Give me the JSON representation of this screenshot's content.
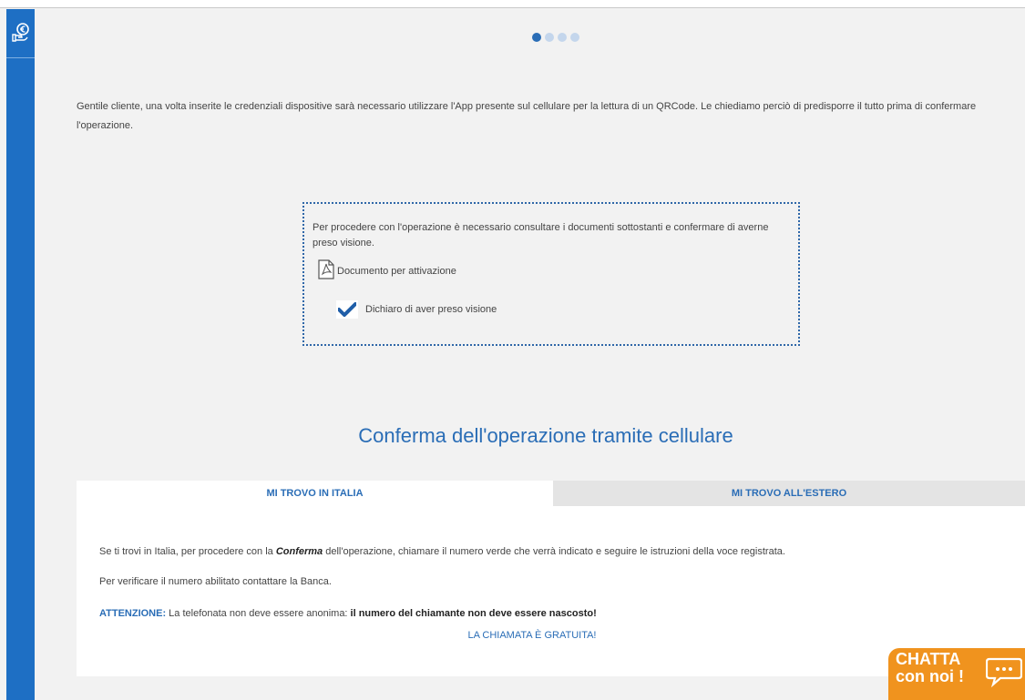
{
  "progress": {
    "total_steps": 4,
    "current_step": 1
  },
  "intro": {
    "text": "Gentile cliente, una volta inserite le credenziali dispositive sarà necessario utilizzare l'App presente sul cellulare per la lettura di un QRCode. Le chiediamo perciò di predisporre il tutto prima di confermare l'operazione."
  },
  "documents": {
    "instruction": "Per procedere con l'operazione è necessario consultare i documenti sottostanti e confermare di averne preso visione.",
    "link_label": "Documento per attivazione",
    "checkbox_label": "Dichiaro di aver preso visione",
    "checkbox_checked": true
  },
  "confirm_section": {
    "heading": "Conferma dell'operazione tramite cellulare",
    "tabs": [
      {
        "label": "MI TROVO IN ITALIA",
        "active": true
      },
      {
        "label": "MI TROVO ALL'ESTERO",
        "active": false
      }
    ],
    "italia": {
      "p1_before": "Se ti trovi in Italia, per procedere con la ",
      "p1_emphasis": "Conferma",
      "p1_after": " dell'operazione, chiamare il numero verde che verrà indicato e seguire le istruzioni della voce registrata.",
      "p2": "Per verificare il numero abilitato contattare la Banca.",
      "attention_label": "ATTENZIONE:",
      "attention_text": " La telefonata non deve essere anonima: ",
      "attention_strong": "il numero del chiamante non deve essere nascosto!",
      "free_call": "LA CHIAMATA È GRATUITA!"
    }
  },
  "chat": {
    "line1": "CHATTA",
    "line2": "con noi !"
  },
  "icons": {
    "sidebar": "euro-hand-icon",
    "document": "pdf-document-icon",
    "checkmark": "checkmark-icon",
    "chat": "chat-bubble-icon"
  },
  "colors": {
    "sidebar": "#1e6fc4",
    "accent": "#2a6db6",
    "chat": "#f0931e",
    "background": "#f2f2f2",
    "tab_inactive": "#e4e4e4"
  }
}
